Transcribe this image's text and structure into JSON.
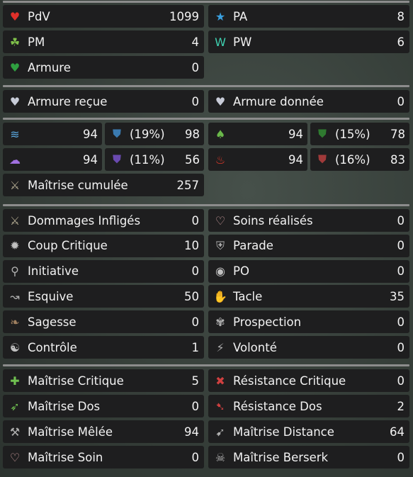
{
  "sections": [
    [
      [
        {
          "label": "PdV",
          "value": "1099",
          "icon": "heart-icon",
          "color": "#e0302a"
        },
        {
          "label": "PA",
          "value": "8",
          "icon": "star-icon",
          "color": "#3aa0e0"
        }
      ],
      [
        {
          "label": "PM",
          "value": "4",
          "icon": "running-man-icon",
          "color": "#7fc04a"
        },
        {
          "label": "PW",
          "value": "6",
          "icon": "wakfu-w-icon",
          "color": "#3fd0b0"
        }
      ],
      [
        {
          "label": "Armure",
          "value": "0",
          "icon": "green-heart-icon",
          "color": "#2fa040"
        },
        null
      ]
    ],
    [
      [
        {
          "label": "Armure reçue",
          "value": "0",
          "icon": "armor-received-icon",
          "color": "#c8ccd8"
        },
        {
          "label": "Armure donnée",
          "value": "0",
          "icon": "armor-given-icon",
          "color": "#c8ccd8"
        }
      ]
    ]
  ],
  "elements": [
    [
      {
        "icon": "water-icon",
        "color": "#5aa8e0",
        "mastery": "94",
        "resist_pct": "(19%)",
        "resist": "98",
        "shield_color": "#3a7ab0"
      },
      {
        "icon": "earth-leaf-icon",
        "color": "#6ab84a",
        "mastery": "94",
        "resist_pct": "(15%)",
        "resist": "78",
        "shield_color": "#2f7a30"
      }
    ],
    [
      {
        "icon": "air-icon",
        "color": "#a070e0",
        "mastery": "94",
        "resist_pct": "(11%)",
        "resist": "56",
        "shield_color": "#6a4ab0"
      },
      {
        "icon": "fire-icon",
        "color": "#e03a2a",
        "mastery": "94",
        "resist_pct": "(16%)",
        "resist": "83",
        "shield_color": "#a03a3a"
      }
    ]
  ],
  "cumulative": {
    "label": "Maîtrise cumulée",
    "value": "257",
    "icon": "sword-icon",
    "color": "#b0a890"
  },
  "secondary": [
    [
      {
        "label": "Dommages Infligés",
        "value": "0",
        "icon": "sword-icon",
        "color": "#b0a890"
      },
      {
        "label": "Soins réalisés",
        "value": "0",
        "icon": "heal-icon",
        "color": "#d0a0a0"
      }
    ],
    [
      {
        "label": "Coup Critique",
        "value": "10",
        "icon": "critical-icon",
        "color": "#c0c0c0"
      },
      {
        "label": "Parade",
        "value": "0",
        "icon": "block-shield-icon",
        "color": "#b0b0b0"
      }
    ],
    [
      {
        "label": "Initiative",
        "value": "0",
        "icon": "initiative-icon",
        "color": "#b0b0b0"
      },
      {
        "label": "PO",
        "value": "0",
        "icon": "range-eye-icon",
        "color": "#c0c0c0"
      }
    ],
    [
      {
        "label": "Esquive",
        "value": "50",
        "icon": "dodge-icon",
        "color": "#b0b0b0"
      },
      {
        "label": "Tacle",
        "value": "35",
        "icon": "lock-hand-icon",
        "color": "#b0b0b0"
      }
    ],
    [
      {
        "label": "Sagesse",
        "value": "0",
        "icon": "wisdom-icon",
        "color": "#a08060"
      },
      {
        "label": "Prospection",
        "value": "0",
        "icon": "prospecting-icon",
        "color": "#b0b0b0"
      }
    ],
    [
      {
        "label": "Contrôle",
        "value": "1",
        "icon": "control-icon",
        "color": "#c0c0c0"
      },
      {
        "label": "Volonté",
        "value": "0",
        "icon": "willpower-icon",
        "color": "#b0b0b0"
      }
    ]
  ],
  "masteries": [
    [
      {
        "label": "Maîtrise Critique",
        "value": "5",
        "icon": "critical-mastery-icon",
        "color": "#70c050"
      },
      {
        "label": "Résistance Critique",
        "value": "0",
        "icon": "critical-resistance-icon",
        "color": "#d04040"
      }
    ],
    [
      {
        "label": "Maîtrise Dos",
        "value": "0",
        "icon": "rear-mastery-icon",
        "color": "#70c050"
      },
      {
        "label": "Résistance Dos",
        "value": "2",
        "icon": "rear-resistance-icon",
        "color": "#d04040"
      }
    ],
    [
      {
        "label": "Maîtrise Mêlée",
        "value": "94",
        "icon": "melee-icon",
        "color": "#b0b0b0"
      },
      {
        "label": "Maîtrise Distance",
        "value": "64",
        "icon": "distance-icon",
        "color": "#b0b0b0"
      }
    ],
    [
      {
        "label": "Maîtrise Soin",
        "value": "0",
        "icon": "heal-icon",
        "color": "#d0a0a0"
      },
      {
        "label": "Maîtrise Berserk",
        "value": "0",
        "icon": "berserk-icon",
        "color": "#b0b0b0"
      }
    ]
  ]
}
